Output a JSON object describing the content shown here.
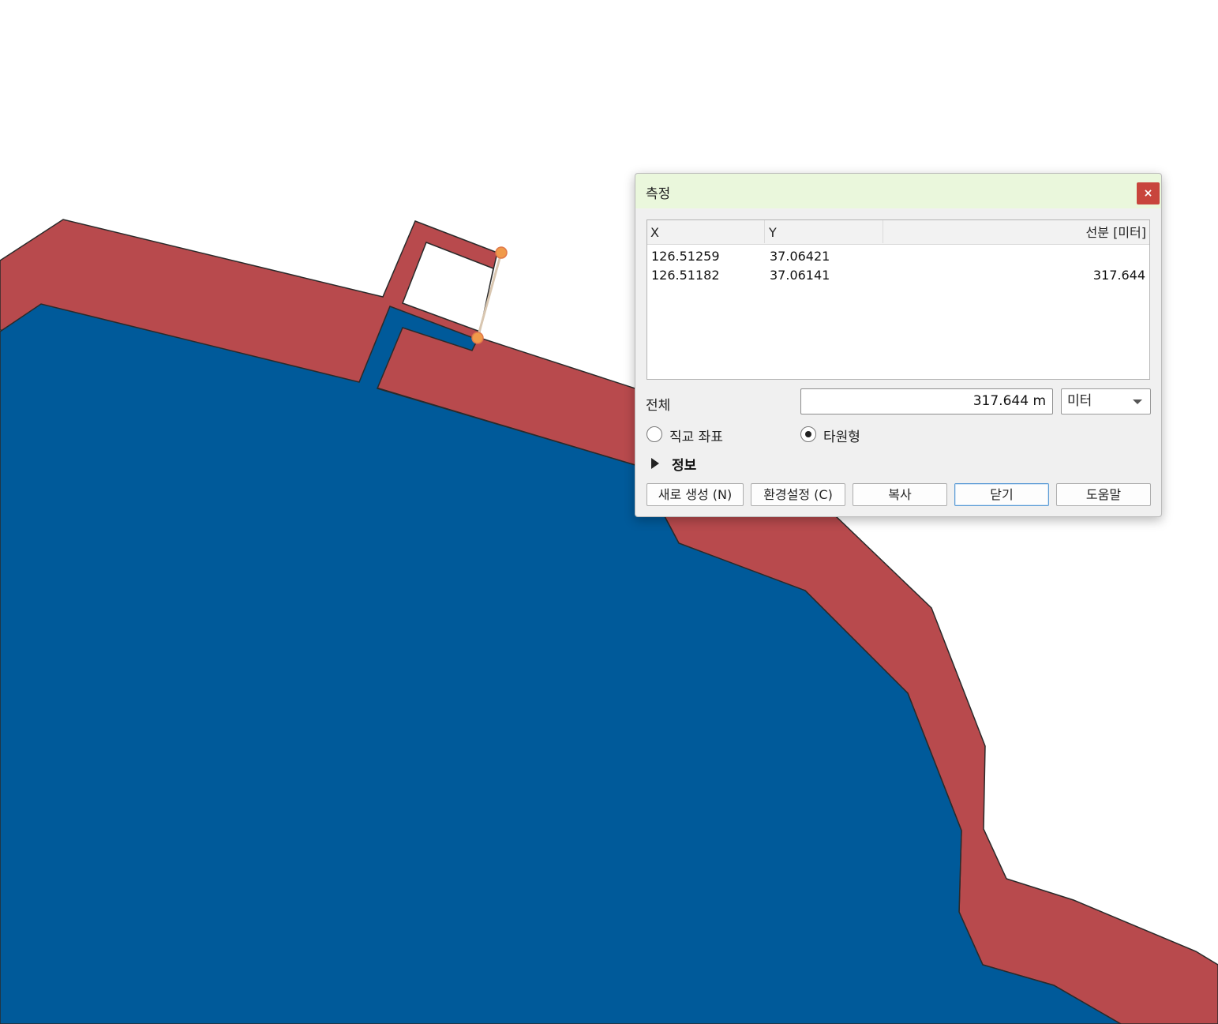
{
  "dialog": {
    "title": "측정",
    "close_label": "×",
    "table": {
      "headers": {
        "x": "X",
        "y": "Y",
        "segment": "선분 [미터]"
      },
      "rows": [
        {
          "x": "126.51259",
          "y": "37.06421",
          "segment": ""
        },
        {
          "x": "126.51182",
          "y": "37.06141",
          "segment": "317.644"
        }
      ]
    },
    "total_label": "전체",
    "total_value": "317.644 m",
    "unit": "미터",
    "radio_cartesian": "직교 좌표",
    "radio_ellipsoidal": "타원형",
    "radio_selected": "ellipsoidal",
    "info_label": "정보",
    "buttons": {
      "new": "새로 생성 (N)",
      "settings": "환경설정 (C)",
      "copy": "복사",
      "close": "닫기",
      "help": "도움말"
    }
  },
  "colors": {
    "land": "#b84a4d",
    "water": "#005a9a",
    "outline": "#2a2a2a",
    "measure_line": "#d8c6b0",
    "measure_point": "#f09a4a",
    "titlebar": "#eaf7dc",
    "close_button": "#c8453c"
  }
}
